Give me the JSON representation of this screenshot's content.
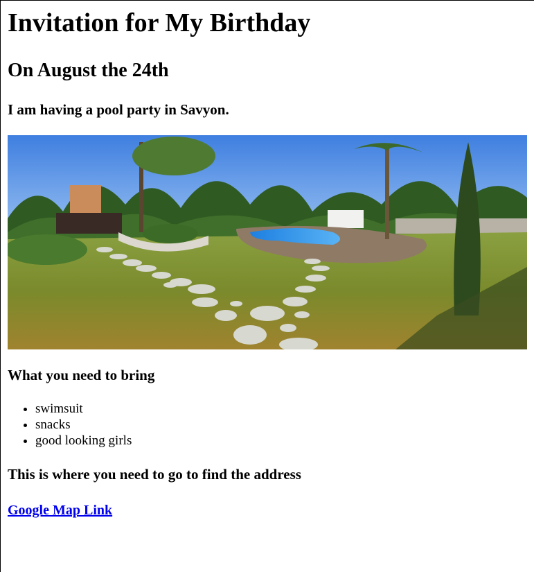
{
  "page": {
    "title": "Invitation for My Birthday",
    "date_heading": "On August the 24th",
    "party_heading": "I am having a pool party in Savyon."
  },
  "image": {
    "subject": "pool-garden-panorama",
    "colors": {
      "sky": "#5f95e6",
      "grass": "#6f8a2a",
      "pool": "#2e8fe8"
    }
  },
  "bring": {
    "heading": "What you need to bring",
    "items": [
      {
        "label": "swimsuit"
      },
      {
        "label": "snacks"
      },
      {
        "label": "good looking girls"
      }
    ]
  },
  "location": {
    "heading": "This is where you need to go to find the address",
    "link_label": "Google Map Link",
    "link_color": "#0000ee"
  }
}
